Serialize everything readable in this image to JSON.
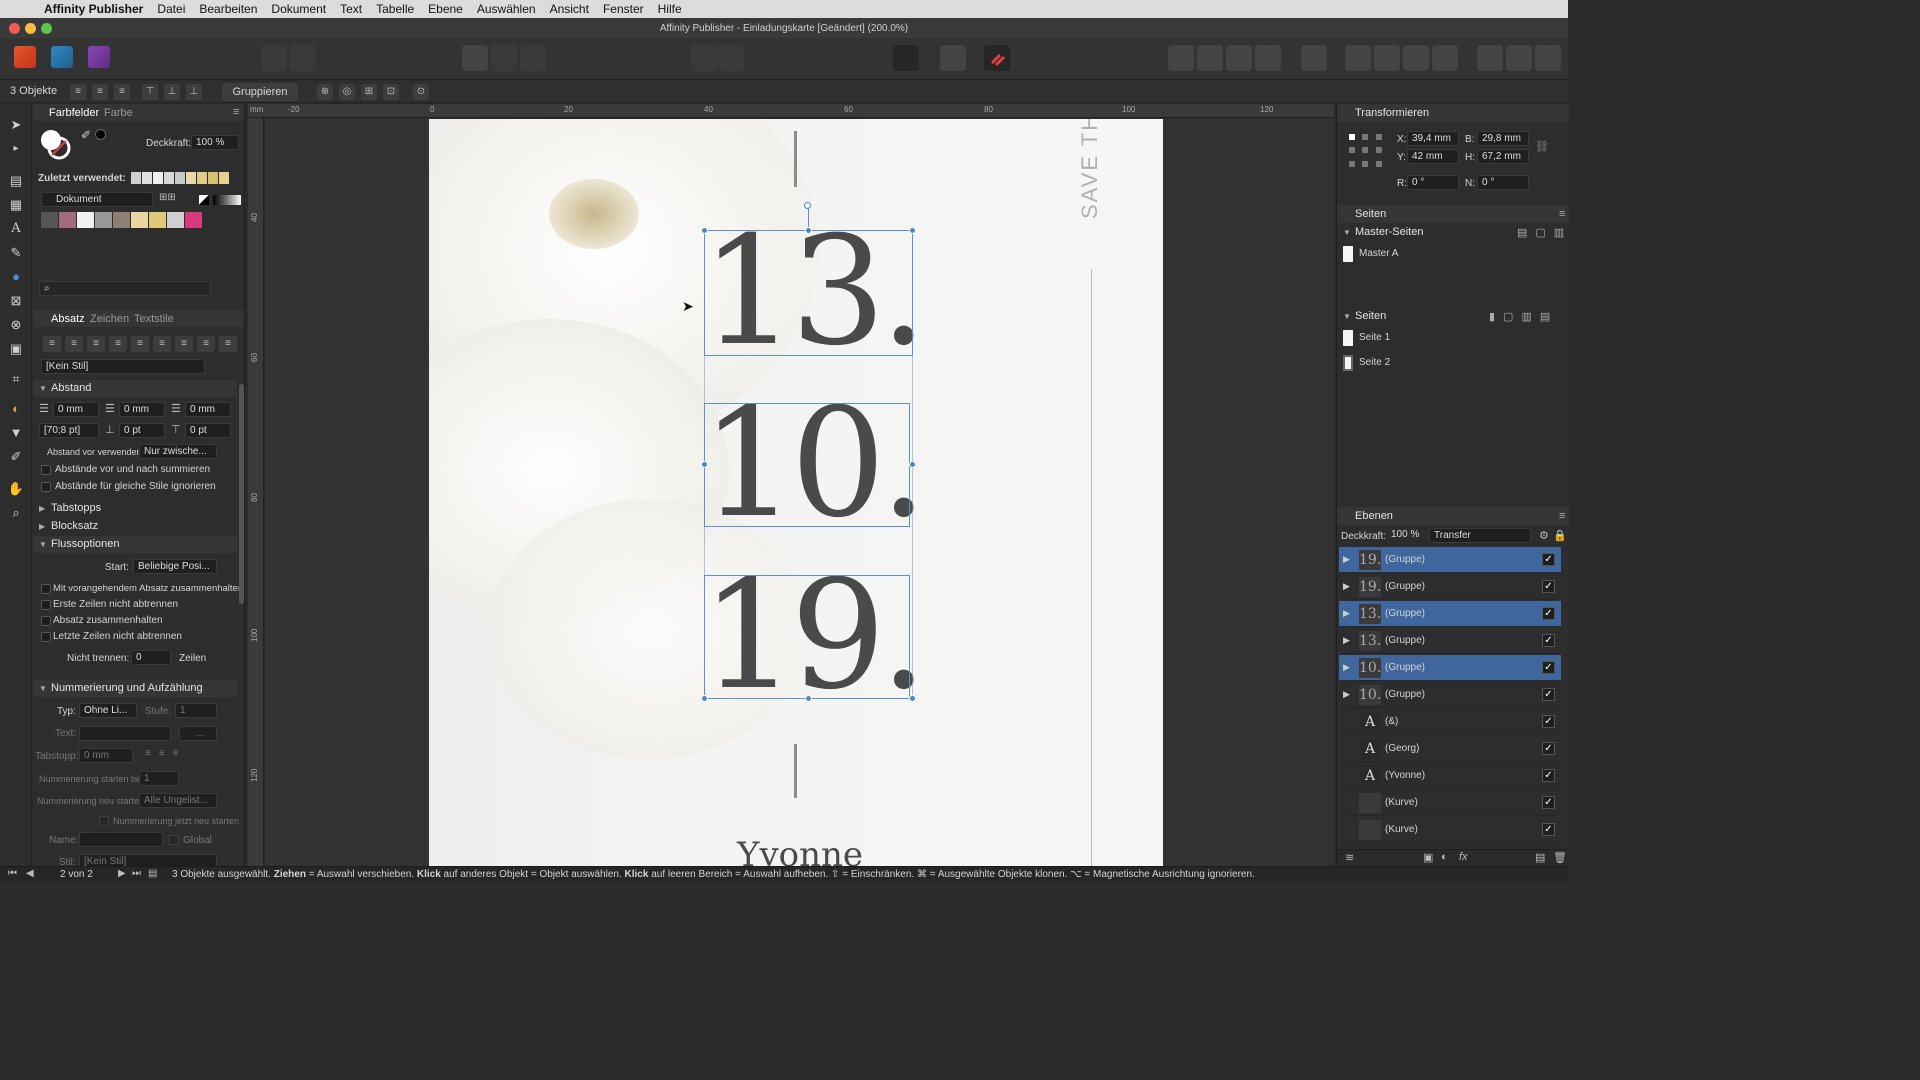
{
  "menubar": {
    "app": "Affinity Publisher",
    "items": [
      "Datei",
      "Bearbeiten",
      "Dokument",
      "Text",
      "Tabelle",
      "Ebene",
      "Auswählen",
      "Ansicht",
      "Fenster",
      "Hilfe"
    ]
  },
  "window": {
    "title": "Affinity Publisher - Einladungskarte [Geändert] (200.0%)"
  },
  "context": {
    "selection_count": "3 Objekte",
    "group_button": "Gruppieren"
  },
  "swatches_panel": {
    "tab_swatches": "Farbfelder",
    "tab_color": "Farbe",
    "opacity_label": "Deckkraft:",
    "opacity_value": "100 %",
    "recent_label": "Zuletzt verwendet:",
    "palette": "Dokument"
  },
  "paragraph_panel": {
    "tab_paragraph": "Absatz",
    "tab_character": "Zeichen",
    "tab_textstyles": "Textstile",
    "style": "[Kein Stil]",
    "section_spacing": "Abstand",
    "indent_left": "0 mm",
    "indent_first": "0 mm",
    "indent_right": "0 mm",
    "leading": "[70;8 pt]",
    "space_before": "0 pt",
    "space_after": "0 pt",
    "space_before_use_label": "Abstand vor verwenden:",
    "space_before_use_value": "Nur zwische...",
    "chk_sum_spacing": "Abstände vor und nach summieren",
    "chk_ignore_same": "Abstände für gleiche Stile ignorieren",
    "section_tabs": "Tabstopps",
    "section_justify": "Blocksatz",
    "section_flow": "Flussoptionen",
    "start_label": "Start:",
    "start_value": "Beliebige Posi...",
    "chk_keep_prev": "Mit vorangehendem Absatz zusammenhalten",
    "chk_keep_first": "Erste Zeilen nicht abtrennen",
    "chk_keep_together": "Absatz zusammenhalten",
    "chk_keep_last": "Letzte Zeilen nicht abtrennen",
    "nobreak_label": "Nicht trennen:",
    "nobreak_value": "0",
    "nobreak_unit": "Zeilen",
    "section_numbering": "Nummerierung und Aufzählung",
    "type_label": "Typ:",
    "type_value": "Ohne Li...",
    "level_label": "Stufe:",
    "level_value": "1",
    "text_label": "Text:",
    "text_more": "...",
    "tabstop_label": "Tabstopp:",
    "tabstop_value": "0 mm",
    "num_start_label": "Nummerierung starten bei:",
    "num_start_value": "1",
    "num_restart_label": "Nummerierung neu starten:",
    "num_restart_value": "Alle Ungelist...",
    "chk_restart_now": "Nummerierung jetzt neu starten",
    "name_label": "Name:",
    "global_label": "Global",
    "style_label": "Stil:",
    "style_value": "[Kein Stil]"
  },
  "ruler": {
    "top_ticks": [
      "-20",
      "0",
      "20",
      "40",
      "60",
      "80",
      "100",
      "120"
    ],
    "left_ticks": [
      "40",
      "60",
      "80",
      "100",
      "120"
    ],
    "unit": "mm"
  },
  "document": {
    "vertical_text": "SAVE THE",
    "numbers": [
      "13.",
      "10.",
      "19."
    ],
    "name_partial": "Yvonne"
  },
  "transform_panel": {
    "title": "Transformieren",
    "x_label": "X:",
    "x": "39,4 mm",
    "y_label": "Y:",
    "y": "42 mm",
    "w_label": "B:",
    "w": "29,8 mm",
    "h_label": "H:",
    "h": "67,2 mm",
    "r_label": "R:",
    "r": "0 °",
    "n_label": "N:",
    "n": "0 °"
  },
  "pages_panel": {
    "title": "Seiten",
    "master_section": "Master-Seiten",
    "master_a": "Master A",
    "pages_section": "Seiten",
    "page1": "Seite 1",
    "page2": "Seite 2"
  },
  "layers_panel": {
    "title": "Ebenen",
    "opacity_label": "Deckkraft:",
    "opacity_value": "100 %",
    "blend": "Transfer",
    "items": [
      {
        "name": "(Gruppe)",
        "thumb": "19.",
        "selected": true,
        "expandable": true
      },
      {
        "name": "(Gruppe)",
        "thumb": "19.",
        "selected": false,
        "expandable": true
      },
      {
        "name": "(Gruppe)",
        "thumb": "13.",
        "selected": true,
        "expandable": true
      },
      {
        "name": "(Gruppe)",
        "thumb": "13.",
        "selected": false,
        "expandable": true
      },
      {
        "name": "(Gruppe)",
        "thumb": "10.",
        "selected": true,
        "expandable": true
      },
      {
        "name": "(Gruppe)",
        "thumb": "10.",
        "selected": false,
        "expandable": true
      },
      {
        "name": "(&)",
        "thumb": "A",
        "selected": false,
        "expandable": false
      },
      {
        "name": "(Georg)",
        "thumb": "A",
        "selected": false,
        "expandable": false
      },
      {
        "name": "(Yvonne)",
        "thumb": "A",
        "selected": false,
        "expandable": false
      },
      {
        "name": "(Kurve)",
        "thumb": "",
        "selected": false,
        "expandable": false
      },
      {
        "name": "(Kurve)",
        "thumb": "",
        "selected": false,
        "expandable": false
      }
    ]
  },
  "statusbar": {
    "page_indicator": "2 von 2",
    "msg_1": "3 Objekte ausgewählt. ",
    "msg_2": "Ziehen",
    "msg_3": " = Auswahl verschieben. ",
    "msg_4": "Klick",
    "msg_5": " auf anderes Objekt = Objekt auswählen. ",
    "msg_6": "Klick",
    "msg_7": " auf leeren Bereich = Auswahl aufheben. ⇧ = Einschränken. ⌘ = Ausgewählte Objekte klonen. ⌥ = Magnetische Ausrichtung ignorieren."
  },
  "colors": {
    "accent": "#3f679d",
    "selection": "#4a86d8",
    "swatch_colors": [
      "#555555",
      "#a06a7f",
      "#f0f0f0",
      "#9a9a9a",
      "#8f7f72",
      "#e8d7a0",
      "#e0c97a",
      "#cfcfcf",
      "#d83a7a"
    ],
    "recent_colors": [
      "#d0d0d0",
      "#e0e0e0",
      "#eeeeee",
      "#d8d8d8",
      "#c8c8c8",
      "#e6d8a8",
      "#e0cc88",
      "#d8c070",
      "#e8d090"
    ]
  }
}
